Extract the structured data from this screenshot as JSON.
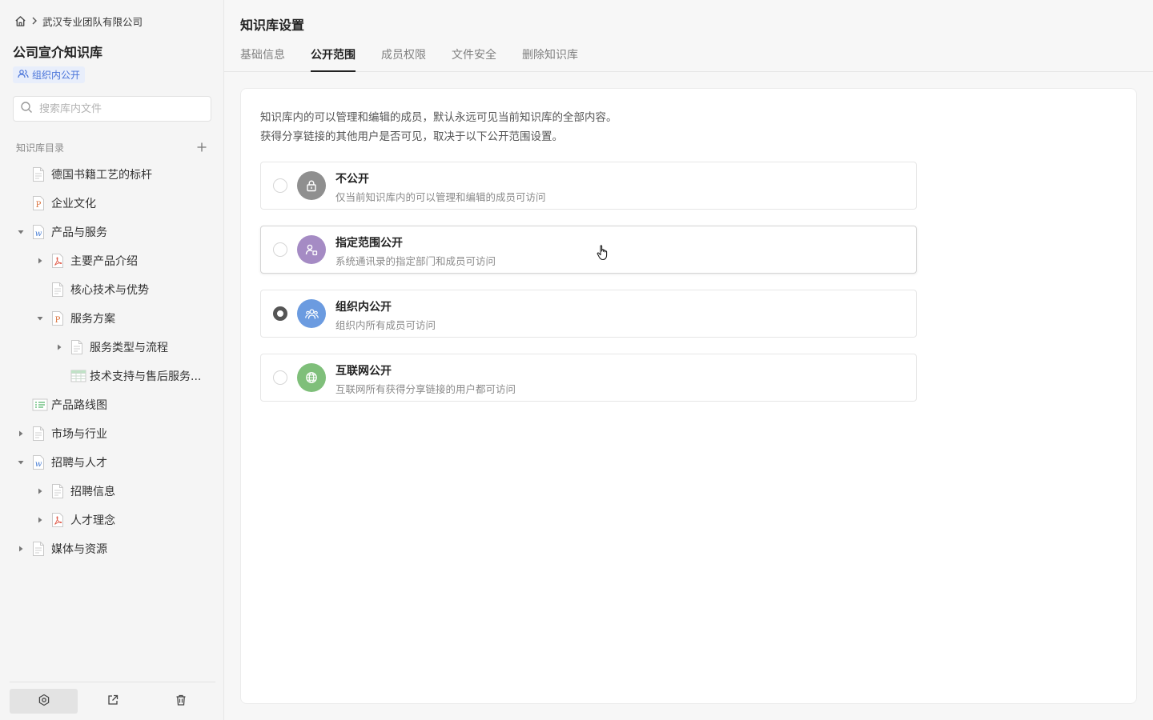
{
  "sidebar": {
    "breadcrumb": {
      "org": "武汉专业团队有限公司"
    },
    "kb_title": "公司宣介知识库",
    "visibility_badge": "组织内公开",
    "search": {
      "placeholder": "搜索库内文件",
      "value": ""
    },
    "toc_title": "知识库目录",
    "tree": [
      {
        "label": "德国书籍工艺的标杆",
        "icon": "doc-icon",
        "expand": "none"
      },
      {
        "label": "企业文化",
        "icon": "ppt-icon",
        "expand": "none"
      },
      {
        "label": "产品与服务",
        "icon": "word-icon",
        "expand": "expanded"
      },
      {
        "label": "主要产品介绍",
        "icon": "pdf-icon",
        "expand": "collapsed"
      },
      {
        "label": "核心技术与优势",
        "icon": "doc-icon",
        "expand": "none"
      },
      {
        "label": "服务方案",
        "icon": "ppt-icon",
        "expand": "expanded"
      },
      {
        "label": "服务类型与流程",
        "icon": "doc-icon",
        "expand": "collapsed"
      },
      {
        "label": "技术支持与售后服务...",
        "icon": "sheet-icon",
        "expand": "none"
      },
      {
        "label": "产品路线图",
        "icon": "mindmap-icon",
        "expand": "none"
      },
      {
        "label": "市场与行业",
        "icon": "doc-icon",
        "expand": "collapsed"
      },
      {
        "label": "招聘与人才",
        "icon": "word-icon",
        "expand": "expanded"
      },
      {
        "label": "招聘信息",
        "icon": "doc-icon",
        "expand": "collapsed"
      },
      {
        "label": "人才理念",
        "icon": "pdf-icon",
        "expand": "collapsed"
      },
      {
        "label": "媒体与资源",
        "icon": "doc-icon",
        "expand": "collapsed"
      }
    ],
    "bottom_actions": [
      "settings-icon",
      "share-icon",
      "trash-icon"
    ]
  },
  "main": {
    "title": "知识库设置",
    "tabs": [
      {
        "label": "基础信息",
        "active": false
      },
      {
        "label": "公开范围",
        "active": true
      },
      {
        "label": "成员权限",
        "active": false
      },
      {
        "label": "文件安全",
        "active": false
      },
      {
        "label": "删除知识库",
        "active": false
      }
    ],
    "description": [
      "知识库内的可以管理和编辑的成员，默认永远可见当前知识库的全部内容。",
      "获得分享链接的其他用户是否可见，取决于以下公开范围设置。"
    ],
    "options": [
      {
        "title": "不公开",
        "subtitle": "仅当前知识库内的可以管理和编辑的成员可访问",
        "icon": "lock-icon",
        "color": "#8f8f8f",
        "checked": false
      },
      {
        "title": "指定范围公开",
        "subtitle": "系统通讯录的指定部门和成员可访问",
        "icon": "people-range-icon",
        "color": "#a58bc4",
        "checked": false
      },
      {
        "title": "组织内公开",
        "subtitle": "组织内所有成员可访问",
        "icon": "group-icon",
        "color": "#6b9be0",
        "checked": true
      },
      {
        "title": "互联网公开",
        "subtitle": "互联网所有获得分享链接的用户都可访问",
        "icon": "globe-icon",
        "color": "#7fbf7a",
        "checked": false
      }
    ]
  }
}
